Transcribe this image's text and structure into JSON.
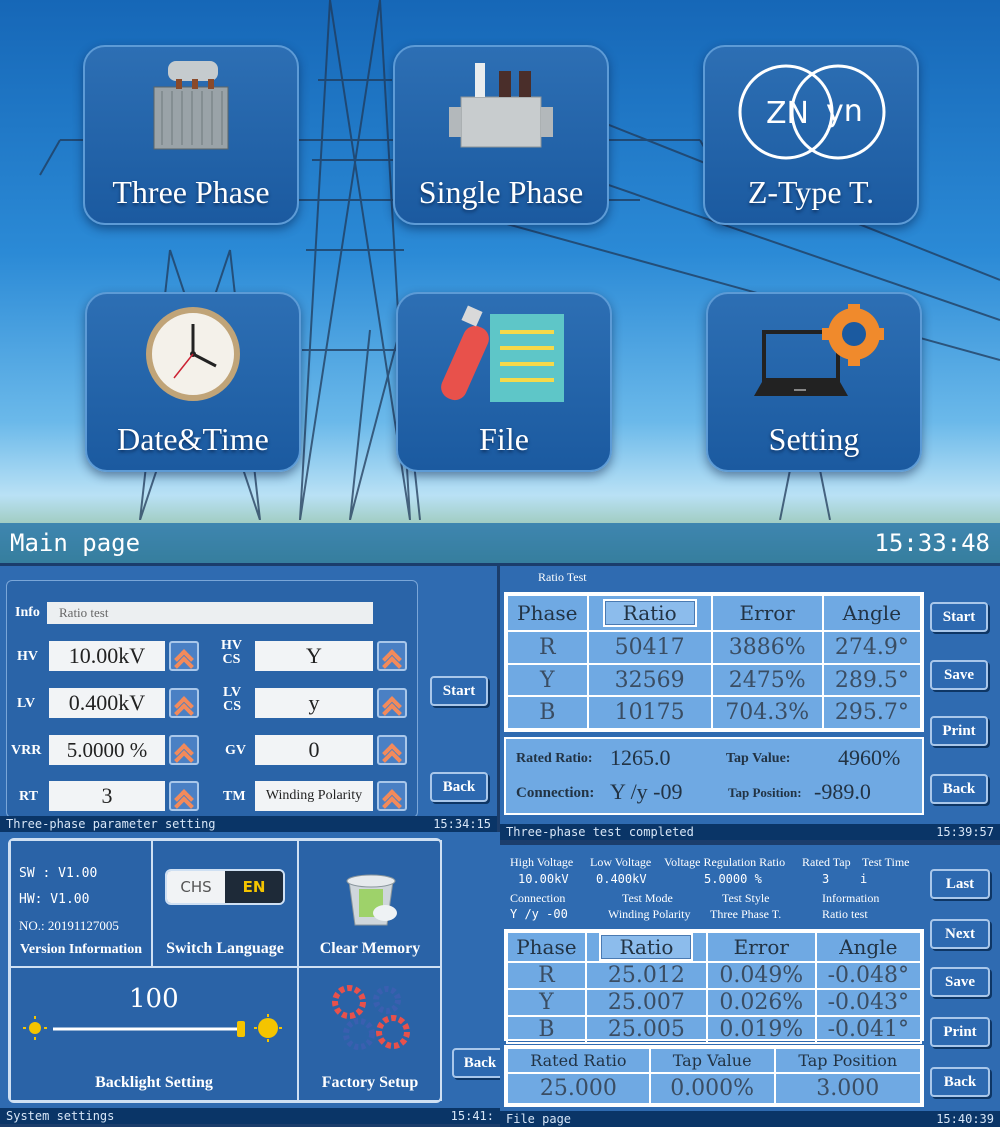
{
  "main_page": {
    "tiles": [
      {
        "label": "Three Phase",
        "icon": "three-phase-transformer-icon"
      },
      {
        "label": "Single Phase",
        "icon": "single-phase-transformer-icon"
      },
      {
        "label": "Z-Type T.",
        "icon": "zn-yn-icon",
        "icon_text_a": "ZN",
        "icon_text_b": "yn"
      },
      {
        "label": "Date&Time",
        "icon": "clock-icon"
      },
      {
        "label": "File",
        "icon": "usb-file-icon"
      },
      {
        "label": "Setting",
        "icon": "laptop-gear-icon"
      }
    ],
    "status_left": "Main page",
    "status_time": "15:33:48"
  },
  "param_page": {
    "info_label": "Info",
    "info_value": "Ratio test",
    "fields": {
      "hv": {
        "label": "HV",
        "value": "10.00kV"
      },
      "lv": {
        "label": "LV",
        "value": "0.400kV"
      },
      "vrr": {
        "label": "VRR",
        "value": "5.0000 %"
      },
      "rt": {
        "label": "RT",
        "value": "3"
      },
      "hvcs": {
        "label_a": "HV",
        "label_b": "CS",
        "value": "Y"
      },
      "lvcs": {
        "label_a": "LV",
        "label_b": "CS",
        "value": "y"
      },
      "gv": {
        "label": "GV",
        "value": "0"
      },
      "tm": {
        "label": "TM",
        "value": "Winding Polarity"
      }
    },
    "start_label": "Start",
    "back_label": "Back",
    "status_left": "Three-phase parameter setting",
    "status_time": "15:34:15"
  },
  "ratio_page": {
    "title": "Ratio Test",
    "headers": [
      "Phase",
      "Ratio",
      "Error",
      "Angle"
    ],
    "rows": [
      [
        "R",
        "50417",
        "3886%",
        "274.9°"
      ],
      [
        "Y",
        "32569",
        "2475%",
        "289.5°"
      ],
      [
        "B",
        "10175",
        "704.3%",
        "295.7°"
      ]
    ],
    "rated_ratio_label": "Rated Ratio:",
    "rated_ratio_value": "1265.0",
    "tap_value_label": "Tap Value:",
    "tap_value_value": "4960%",
    "connection_label": "Connection:",
    "connection_value": "Y /y -09",
    "tap_position_label": "Tap Position:",
    "tap_position_value": "-989.0",
    "buttons": [
      "Start",
      "Save",
      "Print",
      "Back"
    ],
    "status_left": "Three-phase test completed",
    "status_time": "15:39:57"
  },
  "system_page": {
    "sw": "SW : V1.00",
    "hw": "HW: V1.00",
    "no": "NO.: 20191127005",
    "version_caption": "Version Information",
    "lang_chs": "CHS",
    "lang_en": "EN",
    "switch_caption": "Switch Language",
    "clear_caption": "Clear Memory",
    "backlight_value": "100",
    "backlight_level": 1.0,
    "backlight_caption": "Backlight Setting",
    "factory_caption": "Factory Setup",
    "back_label": "Back",
    "status_left": "System settings",
    "status_time": "15:41:"
  },
  "file_page": {
    "info_headers": [
      "High Voltage",
      "Low Voltage",
      "Voltage Regulation Ratio",
      "Rated Tap",
      "Test Time"
    ],
    "info_values": [
      "10.00kV",
      "0.400kV",
      "5.0000 %",
      "3",
      "i"
    ],
    "info_headers2": [
      "Connection",
      "Test Mode",
      "Test Style",
      "Information"
    ],
    "info_values2": [
      "Y /y -00",
      "Winding Polarity",
      "Three Phase T.",
      "Ratio test"
    ],
    "headers": [
      "Phase",
      "Ratio",
      "Error",
      "Angle"
    ],
    "rows": [
      [
        "R",
        "25.012",
        "0.049%",
        "-0.048°"
      ],
      [
        "Y",
        "25.007",
        "0.026%",
        "-0.043°"
      ],
      [
        "B",
        "25.005",
        "0.019%",
        "-0.041°"
      ]
    ],
    "foot_headers": [
      "Rated Ratio",
      "Tap Value",
      "Tap Position"
    ],
    "foot_values": [
      "25.000",
      "0.000%",
      "3.000"
    ],
    "buttons": [
      "Last",
      "Next",
      "Save",
      "Print",
      "Back"
    ],
    "status_left": "File page",
    "status_time": "15:40:39"
  }
}
